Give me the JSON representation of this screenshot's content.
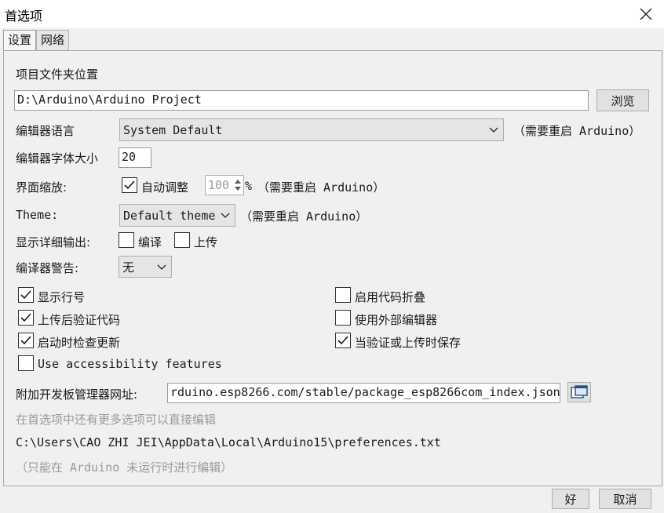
{
  "window": {
    "title": "首选项"
  },
  "tabs": [
    {
      "label": "设置",
      "active": true
    },
    {
      "label": "网络",
      "active": false
    }
  ],
  "sketchbook": {
    "label": "项目文件夹位置",
    "value": "D:\\Arduino\\Arduino Project",
    "browse_label": "浏览"
  },
  "editor_language": {
    "label": "编辑器语言",
    "value": "System Default",
    "note": "（需要重启 Arduino）"
  },
  "font_size": {
    "label": "编辑器字体大小",
    "value": "20"
  },
  "scale": {
    "label": "界面缩放:",
    "auto_label": "自动调整",
    "auto_checked": true,
    "value": "100",
    "unit": "%",
    "note": "（需要重启 Arduino）"
  },
  "theme": {
    "label": "Theme:",
    "value": "Default theme",
    "note": "（需要重启 Arduino）"
  },
  "verbose": {
    "label": "显示详细输出:",
    "compile_label": "编译",
    "compile_checked": false,
    "upload_label": "上传",
    "upload_checked": false
  },
  "warnings": {
    "label": "编译器警告:",
    "value": "无"
  },
  "options": {
    "show_line_numbers": {
      "label": "显示行号",
      "checked": true
    },
    "verify_after_upload": {
      "label": "上传后验证代码",
      "checked": true
    },
    "check_updates": {
      "label": "启动时检查更新",
      "checked": true
    },
    "accessibility": {
      "label": "Use accessibility features",
      "checked": false
    },
    "code_folding": {
      "label": "启用代码折叠",
      "checked": false
    },
    "external_editor": {
      "label": "使用外部编辑器",
      "checked": false
    },
    "save_on_verify": {
      "label": "当验证或上传时保存",
      "checked": true
    }
  },
  "board_urls": {
    "label": "附加开发板管理器网址:",
    "value": "rduino.esp8266.com/stable/package_esp8266com_index.json"
  },
  "more_prefs_hint": "在首选项中还有更多选项可以直接编辑",
  "prefs_path": "C:\\Users\\CAO ZHI JEI\\AppData\\Local\\Arduino15\\preferences.txt",
  "edit_hint": "（只能在 Arduino 未运行时进行编辑）",
  "buttons": {
    "ok": "好",
    "cancel": "取消"
  },
  "colors": {
    "check": "#1a1a1a",
    "hint_gray": "#9a9a9a",
    "background": "#f0f0f0"
  }
}
